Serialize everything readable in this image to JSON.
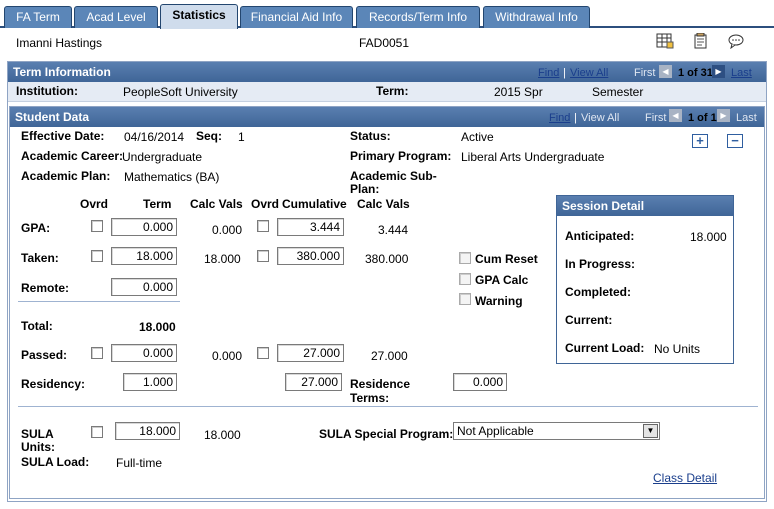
{
  "tabs": [
    {
      "label": "FA Term"
    },
    {
      "label": "Acad Level"
    },
    {
      "label": "Statistics"
    },
    {
      "label": "Financial Aid Info"
    },
    {
      "label": "Records/Term Info"
    },
    {
      "label": "Withdrawal Info"
    }
  ],
  "header": {
    "student_name": "Imanni Hastings",
    "id": "FAD0051",
    "icons": [
      "grid-icon",
      "notepad-icon",
      "chat-bubble-icon"
    ]
  },
  "term_info": {
    "title": "Term Information",
    "find": "Find",
    "sep": "|",
    "view_all": "View All",
    "first": "First",
    "count": "1 of 31",
    "last": "Last",
    "institution_label": "Institution:",
    "institution_value": "PeopleSoft University",
    "term_label": "Term:",
    "term_value": "2015 Spr",
    "term_type": "Semester"
  },
  "student_data": {
    "title": "Student Data",
    "find": "Find",
    "sep": "|",
    "view_all": "View All",
    "first": "First",
    "count": "1 of 1",
    "last": "Last",
    "effective_date_label": "Effective Date:",
    "effective_date_value": "04/16/2014",
    "seq_label": "Seq:",
    "seq_value": "1",
    "status_label": "Status:",
    "status_value": "Active",
    "career_label": "Academic Career:",
    "career_value": "Undergraduate",
    "program_label": "Primary Program:",
    "program_value": "Liberal Arts Undergraduate",
    "plan_label": "Academic Plan:",
    "plan_value": "Mathematics (BA)",
    "subplan_label_1": "Academic Sub-",
    "subplan_label_2": "Plan:"
  },
  "stats": {
    "col_ovrd_1": "Ovrd",
    "col_term": "Term",
    "col_calc_1": "Calc Vals",
    "col_ovrd_2": "Ovrd",
    "col_cumulative": "Cumulative",
    "col_calc_2": "Calc Vals",
    "gpa_label": "GPA:",
    "gpa_term": "0.000",
    "gpa_calc": "0.000",
    "gpa_cum": "3.444",
    "gpa_cum_calc": "3.444",
    "taken_label": "Taken:",
    "taken_term": "18.000",
    "taken_calc": "18.000",
    "taken_cum": "380.000",
    "taken_cum_calc": "380.000",
    "remote_label": "Remote:",
    "remote_term": "0.000",
    "total_label": "Total:",
    "total_value": "18.000",
    "passed_label": "Passed:",
    "passed_term": "0.000",
    "passed_calc": "0.000",
    "passed_cum": "27.000",
    "passed_cum_calc": "27.000",
    "residency_label": "Residency:",
    "residency_term": "1.000",
    "residency_cum": "27.000",
    "residence_terms_label_1": "Residence",
    "residence_terms_label_2": "Terms:",
    "residence_terms_value": "0.000",
    "cum_reset": "Cum Reset",
    "gpa_calc_chk": "GPA Calc",
    "warning": "Warning"
  },
  "session_detail": {
    "title": "Session Detail",
    "anticipated_label": "Anticipated:",
    "anticipated_value": "18.000",
    "in_progress_label": "In Progress:",
    "completed_label": "Completed:",
    "current_label": "Current:",
    "current_load_label": "Current Load:",
    "current_load_value": "No Units"
  },
  "sula": {
    "units_label_1": "SULA",
    "units_label_2": "Units:",
    "units_input": "18.000",
    "units_calc": "18.000",
    "load_label": "SULA Load:",
    "load_value": "Full-time",
    "special_label": "SULA Special Program:",
    "special_value": "Not Applicable",
    "class_detail": "Class Detail"
  },
  "colors": {
    "tab": "#5b86b8",
    "tab_active": "#cfdcec",
    "bar": "#4a70a3",
    "link": "#1a3e8c"
  }
}
